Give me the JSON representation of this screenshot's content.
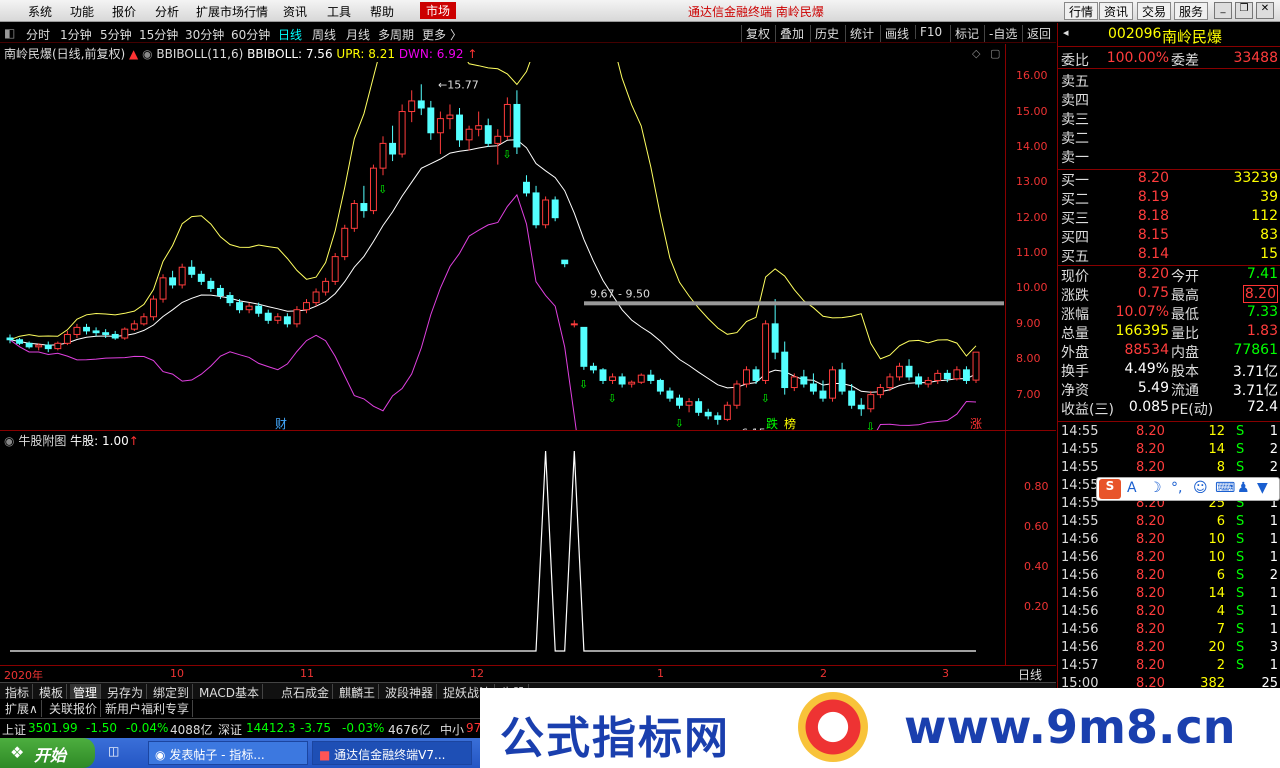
{
  "menubar": {
    "items": [
      "系统",
      "功能",
      "报价",
      "分析",
      "扩展市场行情",
      "资讯",
      "工具",
      "帮助",
      "市场"
    ],
    "title": "通达信金融终端  南岭民爆",
    "right_buttons": [
      "行情",
      "资讯",
      "交易",
      "服务"
    ]
  },
  "tabs": [
    "分时",
    "1分钟",
    "5分钟",
    "15分钟",
    "30分钟",
    "60分钟",
    "日线",
    "周线",
    "月线",
    "多周期",
    "更多"
  ],
  "right_tools": [
    "复权",
    "叠加",
    "历史",
    "统计",
    "画线",
    "F10",
    "标记",
    "-自选",
    "返回"
  ],
  "kinfo": {
    "name": "南岭民爆(日线,前复权)",
    "indicator": "BBIBOLL(11,6)",
    "bbiboll": "BBIBOLL: 7.56",
    "upr": "UPR: 8.21",
    "dwn": "DWN: 6.92"
  },
  "chart_annotations": {
    "high": "15.77",
    "low": "6.15",
    "line_label": "9.67 - 9.50",
    "cai": "财",
    "die": "跌",
    "bang": "榜",
    "zhang": "涨"
  },
  "yaxis_main": [
    "16.00",
    "15.00",
    "14.00",
    "13.00",
    "12.00",
    "11.00",
    "10.00",
    "9.00",
    "8.00",
    "7.00"
  ],
  "indicator": {
    "name": "牛股附图",
    "value": "牛股: 1.00"
  },
  "yaxis_sub": [
    "0.80",
    "0.60",
    "0.40",
    "0.20"
  ],
  "xaxis": [
    "2020年",
    "10",
    "11",
    "12",
    "1",
    "2",
    "3"
  ],
  "period_label": "日线",
  "bottom_tabs": [
    "指标",
    "模板",
    "管理",
    "另存为",
    "绑定到",
    "MACD基本",
    "点石成金",
    "麒麟王",
    "波段神器",
    "捉妖战法",
    "牛股"
  ],
  "bottom_tabs2": [
    "扩展∧",
    "关联报价",
    "新用户福利专享"
  ],
  "index_bar": {
    "sh_label": "上证",
    "sh_val": "3501.99",
    "sh_chg": "-1.50",
    "sh_pct": "-0.04%",
    "sh_amt": "4088亿",
    "sz_label": "深证",
    "sz_val": "14412.3",
    "sz_chg": "-3.75",
    "sz_pct": "-0.03%",
    "sz_amt": "4676亿",
    "zx": "中小",
    "zx_val": "97"
  },
  "stock": {
    "code": "002096",
    "name": "南岭民爆"
  },
  "order_head": {
    "weibi_label": "委比",
    "weibi": "100.00%",
    "weicha_label": "委差",
    "weicha": "33488"
  },
  "sells": [
    "卖五",
    "卖四",
    "卖三",
    "卖二",
    "卖一"
  ],
  "buys": [
    {
      "label": "买一",
      "price": "8.20",
      "vol": "33239"
    },
    {
      "label": "买二",
      "price": "8.19",
      "vol": "39"
    },
    {
      "label": "买三",
      "price": "8.18",
      "vol": "112"
    },
    {
      "label": "买四",
      "price": "8.15",
      "vol": "83"
    },
    {
      "label": "买五",
      "price": "8.14",
      "vol": "15"
    }
  ],
  "quote": [
    {
      "l1": "现价",
      "v1": "8.20",
      "l2": "今开",
      "v2": "7.41"
    },
    {
      "l1": "涨跌",
      "v1": "0.75",
      "l2": "最高",
      "v2": "8.20"
    },
    {
      "l1": "涨幅",
      "v1": "10.07%",
      "l2": "最低",
      "v2": "7.33"
    },
    {
      "l1": "总量",
      "v1": "166395",
      "l2": "量比",
      "v2": "1.83"
    },
    {
      "l1": "外盘",
      "v1": "88534",
      "l2": "内盘",
      "v2": "77861"
    },
    {
      "l1": "换手",
      "v1": "4.49%",
      "l2": "股本",
      "v2": "3.71亿"
    },
    {
      "l1": "净资",
      "v1": "5.49",
      "l2": "流通",
      "v2": "3.71亿"
    },
    {
      "l1": "收益(三)",
      "v1": "0.085",
      "l2": "PE(动)",
      "v2": "72.4"
    }
  ],
  "ticks": [
    {
      "t": "14:55",
      "p": "8.20",
      "v": "12",
      "s": "S",
      "n": "1"
    },
    {
      "t": "14:55",
      "p": "8.20",
      "v": "14",
      "s": "S",
      "n": "2"
    },
    {
      "t": "14:55",
      "p": "8.20",
      "v": "8",
      "s": "S",
      "n": "2"
    },
    {
      "t": "14:55",
      "p": "8.20",
      "v": "",
      "s": "",
      "n": ""
    },
    {
      "t": "14:55",
      "p": "8.20",
      "v": "25",
      "s": "S",
      "n": "1"
    },
    {
      "t": "14:55",
      "p": "8.20",
      "v": "6",
      "s": "S",
      "n": "1"
    },
    {
      "t": "14:56",
      "p": "8.20",
      "v": "10",
      "s": "S",
      "n": "1"
    },
    {
      "t": "14:56",
      "p": "8.20",
      "v": "10",
      "s": "S",
      "n": "1"
    },
    {
      "t": "14:56",
      "p": "8.20",
      "v": "6",
      "s": "S",
      "n": "2"
    },
    {
      "t": "14:56",
      "p": "8.20",
      "v": "14",
      "s": "S",
      "n": "1"
    },
    {
      "t": "14:56",
      "p": "8.20",
      "v": "4",
      "s": "S",
      "n": "1"
    },
    {
      "t": "14:56",
      "p": "8.20",
      "v": "7",
      "s": "S",
      "n": "1"
    },
    {
      "t": "14:56",
      "p": "8.20",
      "v": "20",
      "s": "S",
      "n": "3"
    },
    {
      "t": "14:57",
      "p": "8.20",
      "v": "2",
      "s": "S",
      "n": "1"
    },
    {
      "t": "15:00",
      "p": "8.20",
      "v": "382",
      "s": "",
      "n": "25"
    }
  ],
  "taskbar": {
    "start": "开始",
    "tasks": [
      "发表帖子 - 指标...",
      "通达信金融终端V7..."
    ]
  },
  "banner": {
    "left": "公式指标网",
    "right": "www.9m8.cn"
  },
  "chart_data": {
    "type": "candlestick",
    "title": "南岭民爆(日线,前复权)",
    "ylim": [
      6.0,
      16.4
    ],
    "x_ticks": [
      "2020年",
      "10",
      "11",
      "12",
      "1",
      "2",
      "3"
    ],
    "ohlc": [
      [
        8.6,
        8.7,
        8.45,
        8.55
      ],
      [
        8.55,
        8.6,
        8.4,
        8.45
      ],
      [
        8.45,
        8.5,
        8.3,
        8.35
      ],
      [
        8.35,
        8.45,
        8.25,
        8.4
      ],
      [
        8.4,
        8.5,
        8.2,
        8.3
      ],
      [
        8.3,
        8.5,
        8.25,
        8.45
      ],
      [
        8.45,
        8.8,
        8.4,
        8.7
      ],
      [
        8.7,
        9.0,
        8.6,
        8.9
      ],
      [
        8.9,
        9.0,
        8.7,
        8.8
      ],
      [
        8.8,
        8.9,
        8.65,
        8.75
      ],
      [
        8.75,
        8.85,
        8.6,
        8.7
      ],
      [
        8.7,
        8.8,
        8.55,
        8.6
      ],
      [
        8.6,
        8.9,
        8.55,
        8.85
      ],
      [
        8.85,
        9.1,
        8.8,
        9.0
      ],
      [
        9.0,
        9.3,
        8.95,
        9.2
      ],
      [
        9.2,
        9.8,
        9.1,
        9.7
      ],
      [
        9.7,
        10.4,
        9.6,
        10.3
      ],
      [
        10.3,
        10.5,
        10.0,
        10.1
      ],
      [
        10.1,
        10.7,
        10.0,
        10.6
      ],
      [
        10.6,
        10.8,
        10.3,
        10.4
      ],
      [
        10.4,
        10.5,
        10.1,
        10.2
      ],
      [
        10.2,
        10.3,
        9.9,
        10.0
      ],
      [
        10.0,
        10.1,
        9.7,
        9.8
      ],
      [
        9.8,
        9.9,
        9.5,
        9.6
      ],
      [
        9.6,
        9.7,
        9.3,
        9.4
      ],
      [
        9.4,
        9.6,
        9.3,
        9.5
      ],
      [
        9.5,
        9.6,
        9.2,
        9.3
      ],
      [
        9.3,
        9.4,
        9.0,
        9.1
      ],
      [
        9.1,
        9.3,
        9.0,
        9.2
      ],
      [
        9.2,
        9.3,
        8.9,
        9.0
      ],
      [
        9.0,
        9.5,
        8.9,
        9.4
      ],
      [
        9.4,
        9.7,
        9.3,
        9.6
      ],
      [
        9.6,
        10.0,
        9.5,
        9.9
      ],
      [
        9.9,
        10.3,
        9.8,
        10.2
      ],
      [
        10.2,
        11.0,
        10.1,
        10.9
      ],
      [
        10.9,
        11.8,
        10.8,
        11.7
      ],
      [
        11.7,
        12.5,
        11.6,
        12.4
      ],
      [
        12.4,
        12.9,
        12.0,
        12.2
      ],
      [
        12.2,
        13.5,
        12.1,
        13.4
      ],
      [
        13.4,
        14.3,
        13.2,
        14.1
      ],
      [
        14.1,
        14.6,
        13.6,
        13.8
      ],
      [
        13.8,
        15.2,
        13.7,
        15.0
      ],
      [
        15.0,
        15.6,
        14.7,
        15.3
      ],
      [
        15.3,
        15.77,
        14.9,
        15.1
      ],
      [
        15.1,
        15.3,
        14.2,
        14.4
      ],
      [
        14.4,
        15.0,
        13.8,
        14.8
      ],
      [
        14.8,
        15.2,
        14.5,
        14.9
      ],
      [
        14.9,
        15.1,
        14.0,
        14.2
      ],
      [
        14.2,
        14.6,
        13.9,
        14.5
      ],
      [
        14.5,
        15.0,
        14.3,
        14.6
      ],
      [
        14.6,
        14.8,
        14.0,
        14.1
      ],
      [
        14.1,
        14.5,
        13.5,
        14.3
      ],
      [
        14.3,
        15.4,
        14.2,
        15.2
      ],
      [
        15.2,
        15.6,
        13.8,
        14.0
      ],
      [
        13.0,
        13.2,
        12.6,
        12.7
      ],
      [
        12.7,
        12.9,
        11.7,
        11.8
      ],
      [
        11.8,
        12.6,
        11.7,
        12.5
      ],
      [
        12.5,
        12.6,
        11.9,
        12.0
      ],
      [
        10.8,
        10.8,
        10.6,
        10.7
      ],
      [
        9.0,
        9.1,
        8.9,
        9.0
      ],
      [
        8.9,
        8.9,
        7.7,
        7.8
      ],
      [
        7.8,
        7.9,
        7.6,
        7.7
      ],
      [
        7.7,
        7.75,
        7.3,
        7.4
      ],
      [
        7.4,
        7.6,
        7.3,
        7.5
      ],
      [
        7.5,
        7.6,
        7.2,
        7.3
      ],
      [
        7.3,
        7.4,
        7.2,
        7.35
      ],
      [
        7.35,
        7.6,
        7.3,
        7.55
      ],
      [
        7.55,
        7.7,
        7.3,
        7.4
      ],
      [
        7.4,
        7.45,
        7.0,
        7.1
      ],
      [
        7.1,
        7.2,
        6.8,
        6.9
      ],
      [
        6.9,
        7.0,
        6.6,
        6.7
      ],
      [
        6.7,
        6.9,
        6.5,
        6.8
      ],
      [
        6.8,
        6.9,
        6.4,
        6.5
      ],
      [
        6.5,
        6.6,
        6.3,
        6.4
      ],
      [
        6.4,
        6.5,
        6.15,
        6.3
      ],
      [
        6.3,
        6.8,
        6.25,
        6.7
      ],
      [
        6.7,
        7.4,
        6.6,
        7.3
      ],
      [
        7.3,
        7.8,
        7.2,
        7.7
      ],
      [
        7.7,
        7.8,
        7.3,
        7.4
      ],
      [
        7.4,
        9.1,
        7.3,
        9.0
      ],
      [
        9.0,
        9.7,
        8.0,
        8.2
      ],
      [
        8.2,
        8.5,
        7.0,
        7.2
      ],
      [
        7.2,
        7.6,
        7.1,
        7.5
      ],
      [
        7.5,
        7.7,
        7.2,
        7.3
      ],
      [
        7.3,
        7.6,
        7.0,
        7.1
      ],
      [
        7.1,
        7.4,
        6.8,
        6.9
      ],
      [
        6.9,
        7.8,
        6.8,
        7.7
      ],
      [
        7.7,
        7.9,
        7.0,
        7.1
      ],
      [
        7.1,
        7.3,
        6.6,
        6.7
      ],
      [
        6.7,
        6.9,
        6.4,
        6.6
      ],
      [
        6.6,
        7.1,
        6.5,
        7.0
      ],
      [
        7.0,
        7.3,
        6.9,
        7.2
      ],
      [
        7.2,
        7.6,
        7.1,
        7.5
      ],
      [
        7.5,
        7.9,
        7.4,
        7.8
      ],
      [
        7.8,
        8.0,
        7.4,
        7.5
      ],
      [
        7.5,
        7.6,
        7.2,
        7.3
      ],
      [
        7.3,
        7.5,
        7.2,
        7.4
      ],
      [
        7.4,
        7.7,
        7.3,
        7.6
      ],
      [
        7.6,
        7.7,
        7.35,
        7.45
      ],
      [
        7.45,
        7.8,
        7.4,
        7.7
      ],
      [
        7.7,
        7.8,
        7.3,
        7.4
      ],
      [
        7.41,
        8.2,
        7.33,
        8.2
      ]
    ],
    "series": [
      {
        "name": "BBIBOLL",
        "value": "7.56"
      },
      {
        "name": "UPR",
        "value": "8.21"
      },
      {
        "name": "DWN",
        "value": "6.92"
      }
    ],
    "hline": {
      "value": 9.58,
      "label": "9.67 - 9.50"
    },
    "sub_chart": {
      "name": "牛股",
      "ylim": [
        0,
        1
      ],
      "signals": [
        56,
        59,
        107,
        139
      ]
    }
  }
}
